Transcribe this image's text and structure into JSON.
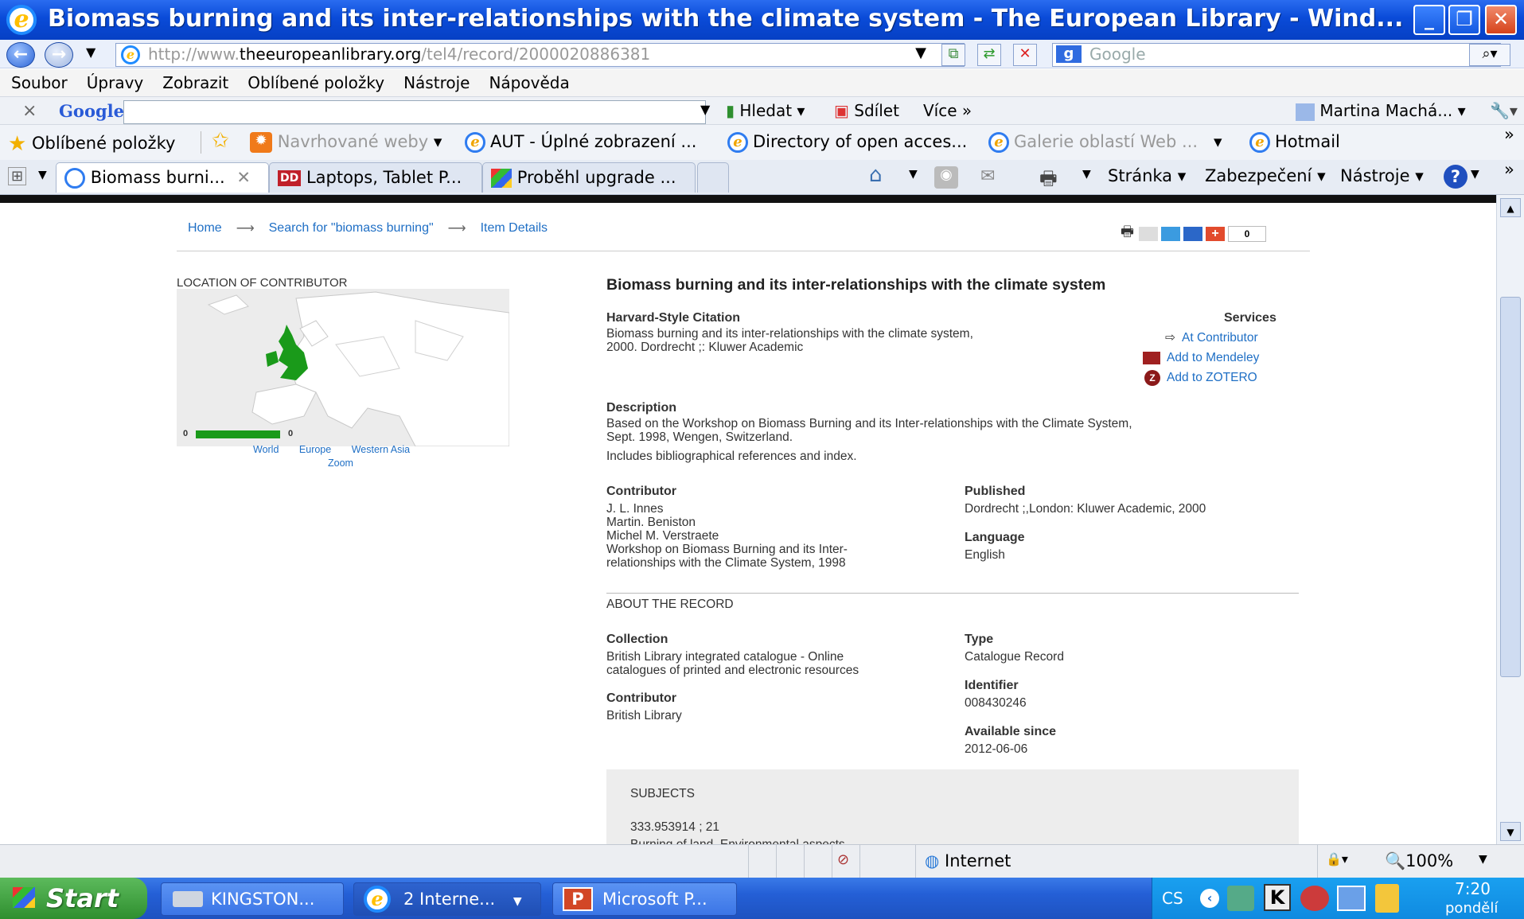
{
  "window": {
    "title": "Biomass burning and its inter-relationships with the climate system - The European Library - Wind...",
    "minimize_label": "_",
    "restore_label": "❐",
    "close_label": "✕"
  },
  "address_bar": {
    "url_prefix": "http://www.",
    "url_domain": "theeuropeanlibrary.org",
    "url_path": "/tel4/record/2000020886381",
    "search_placeholder": "Google"
  },
  "menu": [
    "Soubor",
    "Úpravy",
    "Zobrazit",
    "Oblíbené položky",
    "Nástroje",
    "Nápověda"
  ],
  "google_toolbar": {
    "close": "×",
    "logo": "Google",
    "search_label": "Hledat",
    "share_label": "Sdílet",
    "more_label": "Více",
    "user": "Martina Machá..."
  },
  "favorites": {
    "main": "Oblíbené položky",
    "items": [
      "Navrhované weby",
      "AUT - Úplné zobrazení ...",
      "Directory of open acces...",
      "Galerie oblastí Web ...",
      "Hotmail"
    ]
  },
  "tabs": [
    {
      "label": "Biomass burni..."
    },
    {
      "label": "Laptops, Tablet P..."
    },
    {
      "label": "Proběhl upgrade ..."
    }
  ],
  "command_bar": {
    "page": "Stránka",
    "security": "Zabezpečení",
    "tools": "Nástroje"
  },
  "page": {
    "breadcrumb": [
      {
        "label": "Home"
      },
      {
        "label": "Search for \"biomass burning\""
      },
      {
        "label": "Item Details"
      }
    ],
    "share_count": "0",
    "map": {
      "heading": "LOCATION OF CONTRIBUTOR",
      "legend_min": "0",
      "legend_max": "0",
      "links": [
        "World",
        "Europe",
        "Western Asia"
      ],
      "zoom_label": "Zoom"
    },
    "record": {
      "title": "Biomass burning and its inter-relationships with the climate system",
      "citation_label": "Harvard-Style Citation",
      "citation_lines": [
        "Biomass burning and its inter-relationships with the climate system,",
        "2000. Dordrecht ;: Kluwer Academic"
      ],
      "services_label": "Services",
      "services": [
        "At Contributor",
        "Add to Mendeley",
        "Add to ZOTERO"
      ],
      "description_label": "Description",
      "description_lines": [
        "Based on the Workshop on Biomass Burning and its Inter-relationships with the Climate System,",
        "Sept. 1998, Wengen, Switzerland."
      ],
      "description_note": "Includes bibliographical references and index.",
      "contributor_label": "Contributor",
      "contributors": [
        "J. L. Innes",
        "Martin. Beniston",
        "Michel M. Verstraete",
        "Workshop on Biomass Burning and its Inter-",
        "relationships with the Climate System, 1998"
      ],
      "published_label": "Published",
      "published": "Dordrecht ;,London: Kluwer Academic, 2000",
      "language_label": "Language",
      "language": "English"
    },
    "about": {
      "heading": "ABOUT THE RECORD",
      "collection_label": "Collection",
      "collection_lines": [
        "British Library integrated catalogue - Online",
        "catalogues of printed and electronic resources"
      ],
      "contributor_label": "Contributor",
      "contributor": "British Library",
      "type_label": "Type",
      "type": "Catalogue Record",
      "identifier_label": "Identifier",
      "identifier": "008430246",
      "available_label": "Available since",
      "available": "2012-06-06"
    },
    "subjects": {
      "heading": "SUBJECTS",
      "items": [
        "333.953914 ; 21",
        "Burning of land, Environmental aspects."
      ]
    }
  },
  "status_bar": {
    "zone": "Internet",
    "zoom": "100%"
  },
  "taskbar": {
    "start": "Start",
    "tasks": [
      "KINGSTON...",
      "2 Interne...",
      "Microsoft P..."
    ],
    "language": "CS",
    "time": "7:20",
    "day": "pondělí"
  },
  "colors": {
    "link": "#1f6fc5",
    "map_highlight": "#1a9a1a",
    "titlebar": "#0a4bd8"
  }
}
